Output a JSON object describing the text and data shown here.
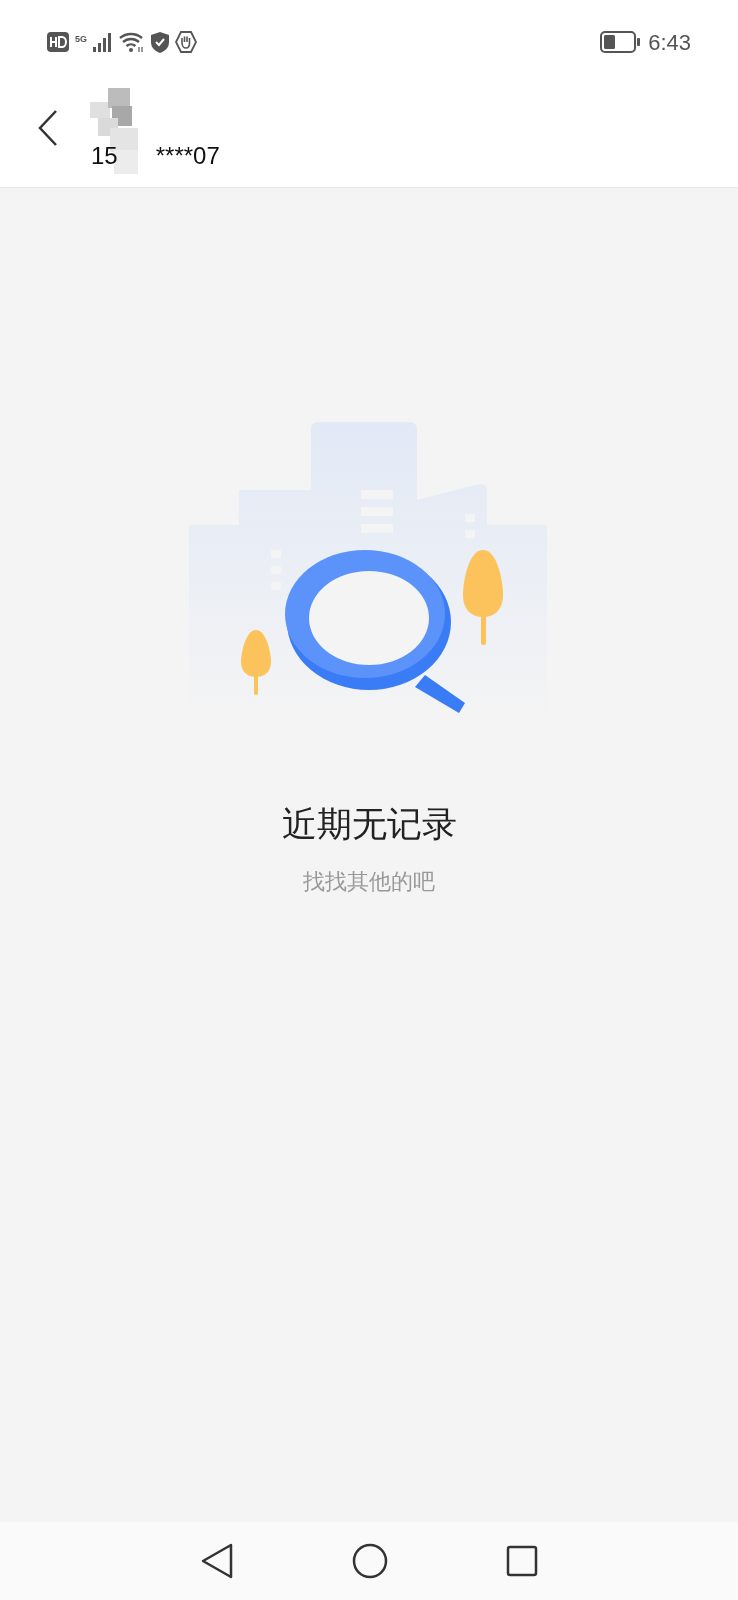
{
  "status_bar": {
    "time": "6:43",
    "network": "5G"
  },
  "header": {
    "phone_start": "15",
    "phone_end": "****07"
  },
  "empty_state": {
    "title": "近期无记录",
    "subtitle": "找找其他的吧"
  }
}
